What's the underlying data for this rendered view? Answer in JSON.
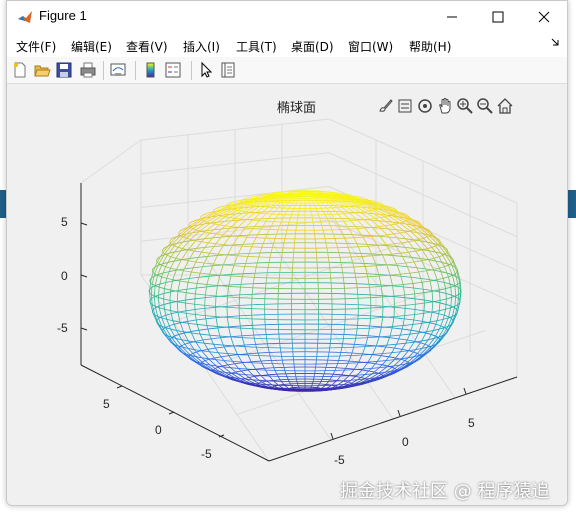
{
  "window": {
    "title": "Figure 1"
  },
  "menu": [
    {
      "label": "文件(F)"
    },
    {
      "label": "编辑(E)"
    },
    {
      "label": "查看(V)"
    },
    {
      "label": "插入(I)"
    },
    {
      "label": "工具(T)"
    },
    {
      "label": "桌面(D)"
    },
    {
      "label": "窗口(W)"
    },
    {
      "label": "帮助(H)"
    }
  ],
  "toolbar": [
    "new-figure-icon",
    "open-file-icon",
    "save-icon",
    "print-icon",
    "link-plot-icon",
    "insert-colorbar-icon",
    "insert-legend-icon",
    "edit-plot-icon",
    "property-inspector-icon"
  ],
  "axes_toolbar": [
    "brush-icon",
    "data-tips-icon",
    "rotate-3d-icon",
    "pan-icon",
    "zoom-in-icon",
    "zoom-out-icon",
    "restore-view-icon"
  ],
  "plot": {
    "title": "椭球面",
    "z_ticks": [
      "5",
      "0",
      "-5"
    ],
    "y_ticks": [
      "5",
      "0",
      "-5"
    ],
    "x_ticks": [
      "5",
      "0",
      "-5"
    ]
  },
  "watermark": "掘金技术社区 @ 程序猿追",
  "colors": {
    "top": "#f9fb0e",
    "bottom": "#3e26a8",
    "window_bg": "#f0f0f0"
  }
}
